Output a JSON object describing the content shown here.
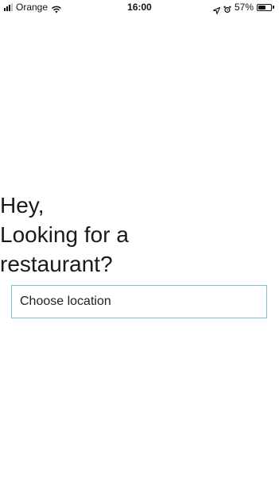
{
  "status_bar": {
    "carrier": "Orange",
    "time": "16:00",
    "battery_percent_label": "57%",
    "battery_level": 0.57,
    "signal_bars_filled": 3,
    "signal_bars_total": 4,
    "icons": [
      "signal-icon",
      "wifi-icon",
      "location-arrow-icon",
      "alarm-icon",
      "battery-icon"
    ]
  },
  "main": {
    "greeting_lines": [
      "Hey,",
      "Looking for a",
      "restaurant?"
    ],
    "location_input": {
      "placeholder": "Choose location",
      "value": ""
    }
  },
  "colors": {
    "background": "#ffffff",
    "text": "#1a1a1a",
    "input_border": "#7ec3d3"
  }
}
